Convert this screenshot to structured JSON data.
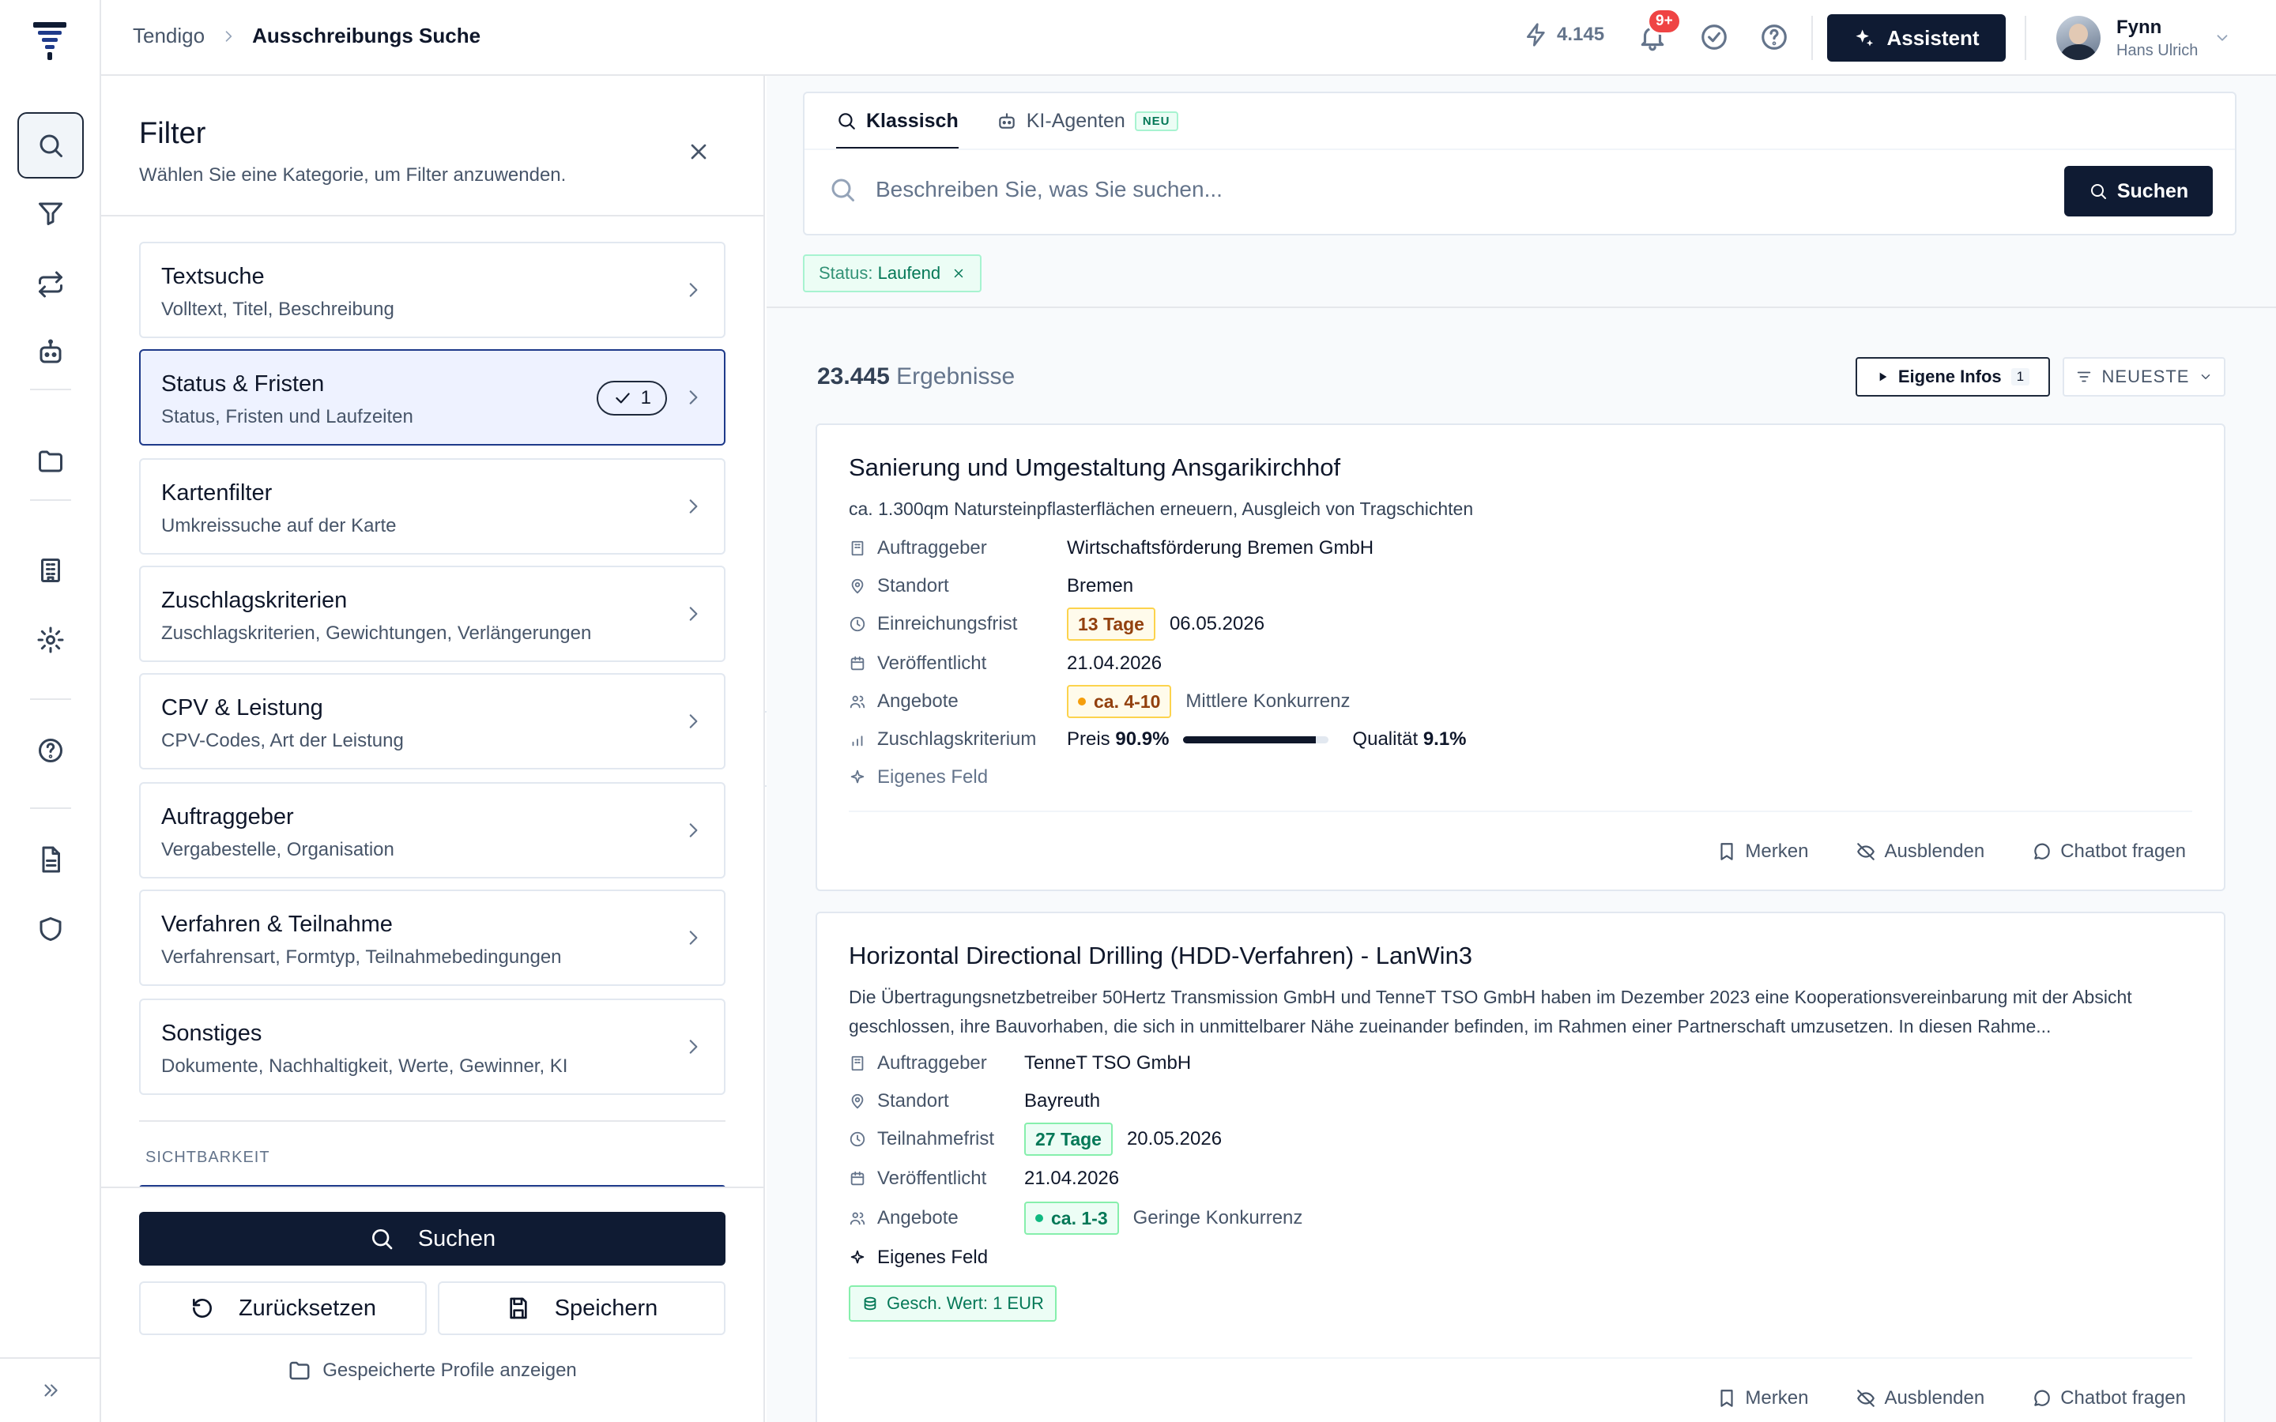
{
  "breadcrumb": {
    "root": "Tendigo",
    "current": "Ausschreibungs Suche"
  },
  "topbar": {
    "credits": "4.145",
    "notifications_badge": "9+",
    "assistant_label": "Assistent"
  },
  "user": {
    "name": "Fynn",
    "role": "Hans Ulrich"
  },
  "rail": {
    "items": [
      "search-icon",
      "filter-icon",
      "repeat-icon",
      "robot-icon",
      "folder-icon",
      "building-icon",
      "gear-icon",
      "help-icon",
      "document-icon",
      "shield-icon"
    ],
    "active": "search-icon"
  },
  "filter": {
    "title": "Filter",
    "subtitle": "Wählen Sie eine Kategorie, um Filter anzuwenden.",
    "categories": [
      {
        "title": "Textsuche",
        "desc": "Volltext, Titel, Beschreibung"
      },
      {
        "title": "Status & Fristen",
        "desc": "Status, Fristen und Laufzeiten",
        "selected": true,
        "count": "1"
      },
      {
        "title": "Kartenfilter",
        "desc": "Umkreissuche auf der Karte"
      },
      {
        "title": "Zuschlagskriterien",
        "desc": "Zuschlagskriterien, Gewichtungen, Verlängerungen"
      },
      {
        "title": "CPV & Leistung",
        "desc": "CPV-Codes, Art der Leistung"
      },
      {
        "title": "Auftraggeber",
        "desc": "Vergabestelle, Organisation"
      },
      {
        "title": "Verfahren & Teilnahme",
        "desc": "Verfahrensart, Formtyp, Teilnahmebedingungen"
      },
      {
        "title": "Sonstiges",
        "desc": "Dokumente, Nachhaltigkeit, Werte, Gewinner, KI"
      }
    ],
    "section_label": "SICHTBARKEIT",
    "search_button": "Suchen",
    "reset_button": "Zurücksetzen",
    "save_button": "Speichern",
    "profiles_link": "Gespeicherte Profile anzeigen"
  },
  "search": {
    "tabs": [
      {
        "label": "Klassisch",
        "active": true
      },
      {
        "label": "KI-Agenten",
        "badge": "NEU"
      }
    ],
    "placeholder": "Beschreiben Sie, was Sie suchen...",
    "value": "",
    "button": "Suchen"
  },
  "active_filter": {
    "label": "Status:",
    "value": "Laufend"
  },
  "results": {
    "count": "23.445",
    "count_label": "Ergebnisse",
    "own_info_label": "Eigene Infos",
    "own_info_count": "1",
    "sort_label": "NEUESTE",
    "actions": {
      "bookmark": "Merken",
      "hide": "Ausblenden",
      "chat": "Chatbot fragen"
    },
    "items": [
      {
        "title": "Sanierung und Umgestaltung Ansgarikirchhof",
        "description": "ca. 1.300qm Natursteinpflasterflächen erneuern, Ausgleich von Tragschichten",
        "fields": {
          "auftraggeber_label": "Auftraggeber",
          "auftraggeber": "Wirtschaftsförderung Bremen GmbH",
          "standort_label": "Standort",
          "standort": "Bremen",
          "frist_label": "Einreichungsfrist",
          "frist_tage": "13 Tage",
          "frist_datum": "06.05.2026",
          "veroeff_label": "Veröffentlicht",
          "veroeff": "21.04.2026",
          "angebote_label": "Angebote",
          "angebote": "ca. 4-10",
          "konkurrenz": "Mittlere Konkurrenz",
          "zuschlag_label": "Zuschlagskriterium",
          "preis_label": "Preis",
          "preis": "90.9%",
          "preis_share": 0.909,
          "qualitaet_label": "Qualität",
          "qualitaet": "9.1%",
          "eigenes_label": "Eigenes Feld"
        },
        "colors": {
          "frist": "#f59e0b",
          "angebote": "#f59e0b"
        }
      },
      {
        "title": "Horizontal Directional Drilling (HDD-Verfahren) - LanWin3",
        "description": "Die Übertragungsnetzbetreiber 50Hertz Transmission GmbH und TenneT TSO GmbH haben im Dezember 2023 eine Kooperationsvereinbarung mit der Absicht geschlossen, ihre Bauvorhaben, die sich in unmittelbarer Nähe zueinander befinden, im Rahmen einer Partnerschaft umzusetzen. In diesen Rahme...",
        "fields": {
          "auftraggeber_label": "Auftraggeber",
          "auftraggeber": "TenneT TSO GmbH",
          "standort_label": "Standort",
          "standort": "Bayreuth",
          "frist_label": "Teilnahmefrist",
          "frist_tage": "27 Tage",
          "frist_datum": "20.05.2026",
          "veroeff_label": "Veröffentlicht",
          "veroeff": "21.04.2026",
          "angebote_label": "Angebote",
          "angebote": "ca. 1-3",
          "konkurrenz": "Geringe Konkurrenz",
          "eigenes_label": "Eigenes Feld",
          "wert": "Gesch. Wert: 1 EUR"
        },
        "colors": {
          "frist": "#10b981",
          "angebote": "#10b981"
        }
      }
    ]
  }
}
